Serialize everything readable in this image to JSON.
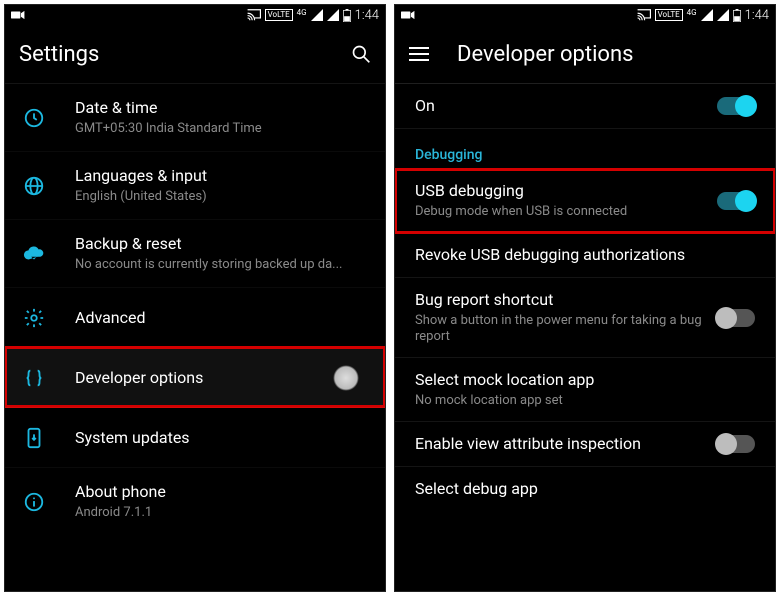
{
  "status": {
    "network_label": "4G",
    "time": "1:44"
  },
  "left": {
    "title": "Settings",
    "items": [
      {
        "icon": "clock",
        "title": "Date & time",
        "subtitle": "GMT+05:30 India Standard Time"
      },
      {
        "icon": "globe",
        "title": "Languages & input",
        "subtitle": "English (United States)"
      },
      {
        "icon": "cloud",
        "title": "Backup & reset",
        "subtitle": "No account is currently storing backed up da..."
      },
      {
        "icon": "gear",
        "title": "Advanced",
        "subtitle": ""
      },
      {
        "icon": "braces",
        "title": "Developer options",
        "subtitle": ""
      },
      {
        "icon": "phone-update",
        "title": "System updates",
        "subtitle": ""
      },
      {
        "icon": "info",
        "title": "About phone",
        "subtitle": "Android 7.1.1"
      }
    ]
  },
  "right": {
    "title": "Developer options",
    "master_on_label": "On",
    "master_on": true,
    "section_label": "Debugging",
    "items": [
      {
        "title": "USB debugging",
        "subtitle": "Debug mode when USB is connected",
        "toggle": true,
        "on": true,
        "highlight": true
      },
      {
        "title": "Revoke USB debugging authorizations",
        "subtitle": "",
        "toggle": false
      },
      {
        "title": "Bug report shortcut",
        "subtitle": "Show a button in the power menu for taking a bug report",
        "toggle": true,
        "on": false
      },
      {
        "title": "Select mock location app",
        "subtitle": "No mock location app set",
        "toggle": false
      },
      {
        "title": "Enable view attribute inspection",
        "subtitle": "",
        "toggle": true,
        "on": false
      },
      {
        "title": "Select debug app",
        "subtitle": "",
        "toggle": false
      }
    ]
  }
}
